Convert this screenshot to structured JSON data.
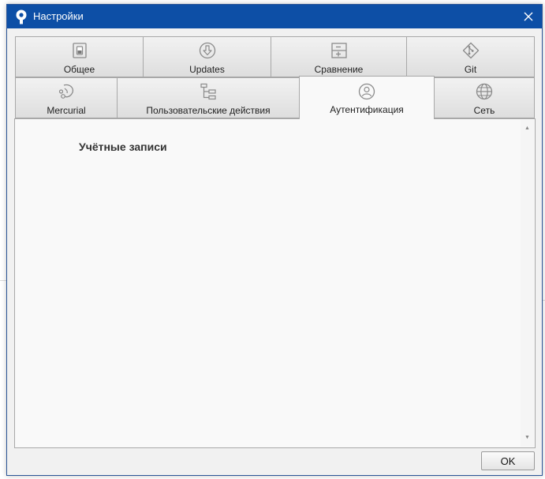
{
  "window": {
    "title": "Настройки",
    "colors": {
      "titlebar": "#0d4fa6",
      "accent_icon": "#8a8a8a"
    }
  },
  "tabs": {
    "row1": [
      {
        "label": "Общее",
        "icon": "toggle-switch-icon"
      },
      {
        "label": "Updates",
        "icon": "download-circle-icon"
      },
      {
        "label": "Сравнение",
        "icon": "diff-icon"
      },
      {
        "label": "Git",
        "icon": "git-diamond-icon"
      }
    ],
    "row2": [
      {
        "label": "Mercurial",
        "icon": "mercurial-icon"
      },
      {
        "label": "Пользовательские действия",
        "icon": "flowchart-icon"
      },
      {
        "label": "Аутентификация",
        "icon": "user-circle-icon",
        "active": true
      },
      {
        "label": "Сеть",
        "icon": "globe-icon"
      }
    ]
  },
  "content": {
    "section_title": "Учётные записи"
  },
  "footer": {
    "ok_label": "OK"
  }
}
